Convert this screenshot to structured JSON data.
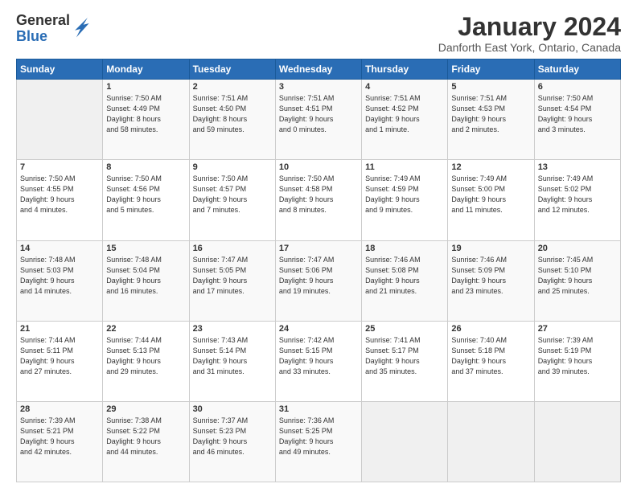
{
  "logo": {
    "general": "General",
    "blue": "Blue"
  },
  "title": "January 2024",
  "location": "Danforth East York, Ontario, Canada",
  "weekdays": [
    "Sunday",
    "Monday",
    "Tuesday",
    "Wednesday",
    "Thursday",
    "Friday",
    "Saturday"
  ],
  "weeks": [
    [
      {
        "day": "",
        "info": ""
      },
      {
        "day": "1",
        "info": "Sunrise: 7:50 AM\nSunset: 4:49 PM\nDaylight: 8 hours\nand 58 minutes."
      },
      {
        "day": "2",
        "info": "Sunrise: 7:51 AM\nSunset: 4:50 PM\nDaylight: 8 hours\nand 59 minutes."
      },
      {
        "day": "3",
        "info": "Sunrise: 7:51 AM\nSunset: 4:51 PM\nDaylight: 9 hours\nand 0 minutes."
      },
      {
        "day": "4",
        "info": "Sunrise: 7:51 AM\nSunset: 4:52 PM\nDaylight: 9 hours\nand 1 minute."
      },
      {
        "day": "5",
        "info": "Sunrise: 7:51 AM\nSunset: 4:53 PM\nDaylight: 9 hours\nand 2 minutes."
      },
      {
        "day": "6",
        "info": "Sunrise: 7:50 AM\nSunset: 4:54 PM\nDaylight: 9 hours\nand 3 minutes."
      }
    ],
    [
      {
        "day": "7",
        "info": "Sunrise: 7:50 AM\nSunset: 4:55 PM\nDaylight: 9 hours\nand 4 minutes."
      },
      {
        "day": "8",
        "info": "Sunrise: 7:50 AM\nSunset: 4:56 PM\nDaylight: 9 hours\nand 5 minutes."
      },
      {
        "day": "9",
        "info": "Sunrise: 7:50 AM\nSunset: 4:57 PM\nDaylight: 9 hours\nand 7 minutes."
      },
      {
        "day": "10",
        "info": "Sunrise: 7:50 AM\nSunset: 4:58 PM\nDaylight: 9 hours\nand 8 minutes."
      },
      {
        "day": "11",
        "info": "Sunrise: 7:49 AM\nSunset: 4:59 PM\nDaylight: 9 hours\nand 9 minutes."
      },
      {
        "day": "12",
        "info": "Sunrise: 7:49 AM\nSunset: 5:00 PM\nDaylight: 9 hours\nand 11 minutes."
      },
      {
        "day": "13",
        "info": "Sunrise: 7:49 AM\nSunset: 5:02 PM\nDaylight: 9 hours\nand 12 minutes."
      }
    ],
    [
      {
        "day": "14",
        "info": "Sunrise: 7:48 AM\nSunset: 5:03 PM\nDaylight: 9 hours\nand 14 minutes."
      },
      {
        "day": "15",
        "info": "Sunrise: 7:48 AM\nSunset: 5:04 PM\nDaylight: 9 hours\nand 16 minutes."
      },
      {
        "day": "16",
        "info": "Sunrise: 7:47 AM\nSunset: 5:05 PM\nDaylight: 9 hours\nand 17 minutes."
      },
      {
        "day": "17",
        "info": "Sunrise: 7:47 AM\nSunset: 5:06 PM\nDaylight: 9 hours\nand 19 minutes."
      },
      {
        "day": "18",
        "info": "Sunrise: 7:46 AM\nSunset: 5:08 PM\nDaylight: 9 hours\nand 21 minutes."
      },
      {
        "day": "19",
        "info": "Sunrise: 7:46 AM\nSunset: 5:09 PM\nDaylight: 9 hours\nand 23 minutes."
      },
      {
        "day": "20",
        "info": "Sunrise: 7:45 AM\nSunset: 5:10 PM\nDaylight: 9 hours\nand 25 minutes."
      }
    ],
    [
      {
        "day": "21",
        "info": "Sunrise: 7:44 AM\nSunset: 5:11 PM\nDaylight: 9 hours\nand 27 minutes."
      },
      {
        "day": "22",
        "info": "Sunrise: 7:44 AM\nSunset: 5:13 PM\nDaylight: 9 hours\nand 29 minutes."
      },
      {
        "day": "23",
        "info": "Sunrise: 7:43 AM\nSunset: 5:14 PM\nDaylight: 9 hours\nand 31 minutes."
      },
      {
        "day": "24",
        "info": "Sunrise: 7:42 AM\nSunset: 5:15 PM\nDaylight: 9 hours\nand 33 minutes."
      },
      {
        "day": "25",
        "info": "Sunrise: 7:41 AM\nSunset: 5:17 PM\nDaylight: 9 hours\nand 35 minutes."
      },
      {
        "day": "26",
        "info": "Sunrise: 7:40 AM\nSunset: 5:18 PM\nDaylight: 9 hours\nand 37 minutes."
      },
      {
        "day": "27",
        "info": "Sunrise: 7:39 AM\nSunset: 5:19 PM\nDaylight: 9 hours\nand 39 minutes."
      }
    ],
    [
      {
        "day": "28",
        "info": "Sunrise: 7:39 AM\nSunset: 5:21 PM\nDaylight: 9 hours\nand 42 minutes."
      },
      {
        "day": "29",
        "info": "Sunrise: 7:38 AM\nSunset: 5:22 PM\nDaylight: 9 hours\nand 44 minutes."
      },
      {
        "day": "30",
        "info": "Sunrise: 7:37 AM\nSunset: 5:23 PM\nDaylight: 9 hours\nand 46 minutes."
      },
      {
        "day": "31",
        "info": "Sunrise: 7:36 AM\nSunset: 5:25 PM\nDaylight: 9 hours\nand 49 minutes."
      },
      {
        "day": "",
        "info": ""
      },
      {
        "day": "",
        "info": ""
      },
      {
        "day": "",
        "info": ""
      }
    ]
  ]
}
